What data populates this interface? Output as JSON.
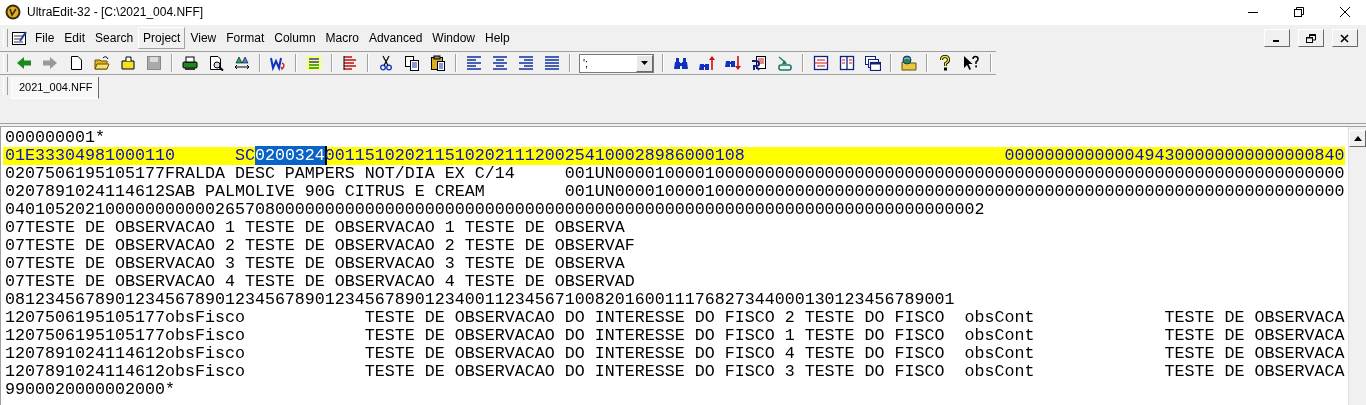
{
  "window": {
    "title": "UltraEdit-32 - [C:\\2021_004.NFF]"
  },
  "menu": [
    {
      "label": "File",
      "hovered": false
    },
    {
      "label": "Edit",
      "hovered": false
    },
    {
      "label": "Search",
      "hovered": false
    },
    {
      "label": "Project",
      "hovered": true
    },
    {
      "label": "View",
      "hovered": false
    },
    {
      "label": "Format",
      "hovered": false
    },
    {
      "label": "Column",
      "hovered": false
    },
    {
      "label": "Macro",
      "hovered": false
    },
    {
      "label": "Advanced",
      "hovered": false
    },
    {
      "label": "Window",
      "hovered": false
    },
    {
      "label": "Help",
      "hovered": false
    }
  ],
  "toolbar": {
    "combo": {
      "value": "';"
    }
  },
  "tabs": [
    {
      "label": "2021_004.NFF",
      "selected": true
    }
  ],
  "editor": {
    "lines": [
      {
        "highlighted": false,
        "segments": [
          {
            "text": "000000001*",
            "selected": false
          }
        ]
      },
      {
        "highlighted": true,
        "segments": [
          {
            "text": "01E33304981000110      SC",
            "selected": false
          },
          {
            "text": "0200324",
            "selected": true
          },
          {
            "text": "001151020211510202111200254100028986000108                          0000000000000494300000000000000840",
            "selected": false
          }
        ]
      },
      {
        "highlighted": false,
        "segments": [
          {
            "text": "0207506195105177FRALDA DESC PAMPERS NOT/DIA EX C/14     001UN0000100001000000000000000000000000000000000000000000000000000000000000000",
            "selected": false
          }
        ]
      },
      {
        "highlighted": false,
        "segments": [
          {
            "text": "0207891024114612SAB PALMOLIVE 90G CITRUS E CREAM        001UN0000100001000000000000000000000000000000000000000000000000000000000000000",
            "selected": false
          }
        ]
      },
      {
        "highlighted": false,
        "segments": [
          {
            "text": "04010520210000000000026570800000000000000000000000000000000000000000000000000000000000000000000002",
            "selected": false
          }
        ]
      },
      {
        "highlighted": false,
        "segments": [
          {
            "text": "07TESTE DE OBSERVACAO 1 TESTE DE OBSERVACAO 1 TESTE DE OBSERVA",
            "selected": false
          }
        ]
      },
      {
        "highlighted": false,
        "segments": [
          {
            "text": "07TESTE DE OBSERVACAO 2 TESTE DE OBSERVACAO 2 TESTE DE OBSERVAF",
            "selected": false
          }
        ]
      },
      {
        "highlighted": false,
        "segments": [
          {
            "text": "07TESTE DE OBSERVACAO 3 TESTE DE OBSERVACAO 3 TESTE DE OBSERVA",
            "selected": false
          }
        ]
      },
      {
        "highlighted": false,
        "segments": [
          {
            "text": "07TESTE DE OBSERVACAO 4 TESTE DE OBSERVACAO 4 TESTE DE OBSERVAD",
            "selected": false
          }
        ]
      },
      {
        "highlighted": false,
        "segments": [
          {
            "text": "08123456789012345678901234567890123456789012340011234567100820160011176827344000130123456789001",
            "selected": false
          }
        ]
      },
      {
        "highlighted": false,
        "segments": [
          {
            "text": "1207506195105177obsFisco            TESTE DE OBSERVACAO DO INTERESSE DO FISCO 2 TESTE DO FISCO  obsCont             TESTE DE OBSERVACA",
            "selected": false
          }
        ]
      },
      {
        "highlighted": false,
        "segments": [
          {
            "text": "1207506195105177obsFisco            TESTE DE OBSERVACAO DO INTERESSE DO FISCO 1 TESTE DO FISCO  obsCont             TESTE DE OBSERVACA",
            "selected": false
          }
        ]
      },
      {
        "highlighted": false,
        "segments": [
          {
            "text": "1207891024114612obsFisco            TESTE DE OBSERVACAO DO INTERESSE DO FISCO 4 TESTE DO FISCO  obsCont             TESTE DE OBSERVACA",
            "selected": false
          }
        ]
      },
      {
        "highlighted": false,
        "segments": [
          {
            "text": "1207891024114612obsFisco            TESTE DE OBSERVACAO DO INTERESSE DO FISCO 3 TESTE DO FISCO  obsCont             TESTE DE OBSERVACA",
            "selected": false
          }
        ]
      },
      {
        "highlighted": false,
        "segments": [
          {
            "text": "9900020000002000*",
            "selected": false
          }
        ]
      }
    ]
  }
}
